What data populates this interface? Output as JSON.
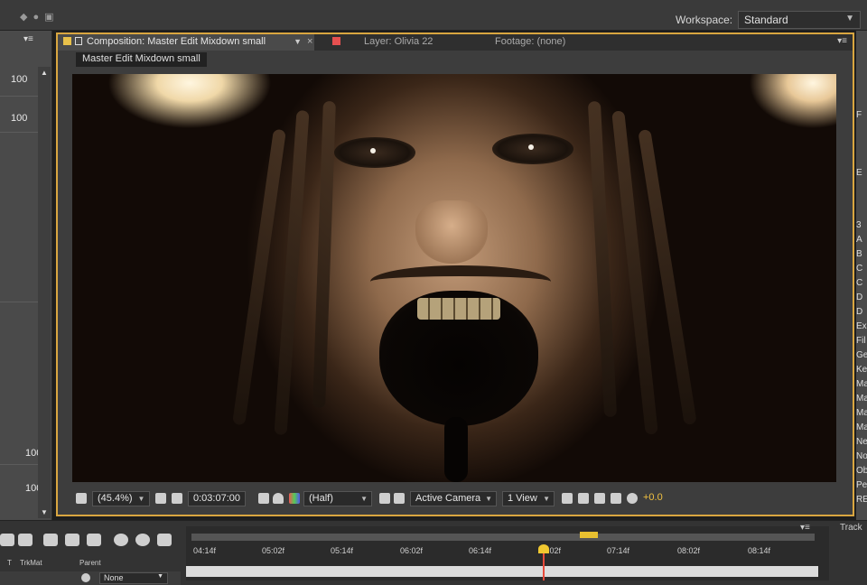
{
  "workspace": {
    "label": "Workspace:",
    "value": "Standard"
  },
  "left_panel": {
    "menu_glyph": "▾≡",
    "values": [
      "100",
      "100",
      "100",
      "100"
    ]
  },
  "comp_panel": {
    "tab_comp": "Composition: Master Edit Mixdown small",
    "tab_layer": "Layer: Olivia 22",
    "tab_footage": "Footage: (none)",
    "close_glyph": "×",
    "menu_glyph": "▾≡",
    "breadcrumb": "Master Edit Mixdown small"
  },
  "viewer_toolbar": {
    "zoom": "(45.4%)",
    "timecode": "0:03:07:00",
    "resolution": "(Half)",
    "camera": "Active Camera",
    "views": "1 View",
    "exposure": "+0.0"
  },
  "right_strip": {
    "items": [
      "F",
      "E",
      "3",
      "A",
      "B",
      "C",
      "C",
      "D",
      "D",
      "Ex",
      "Fil",
      "Ge",
      "Ke",
      "Ma",
      "Ma",
      "Ma",
      "Ma",
      "Ne",
      "No",
      "Ob",
      "Pers",
      "RE:"
    ]
  },
  "timeline": {
    "columns": {
      "t": "T",
      "trkmat": "TrkMat",
      "parent": "Parent"
    },
    "parent_value": "None",
    "ticks": [
      "04:14f",
      "05:02f",
      "05:14f",
      "06:02f",
      "06:14f",
      "07:02f",
      "07:14f",
      "08:02f",
      "08:14f"
    ],
    "tracker_label": "Track",
    "menu_glyph": "▾≡"
  },
  "colors": {
    "active_panel_border": "#d9a640",
    "cti": "#f0c830",
    "layer_swatch": "#e65050"
  }
}
